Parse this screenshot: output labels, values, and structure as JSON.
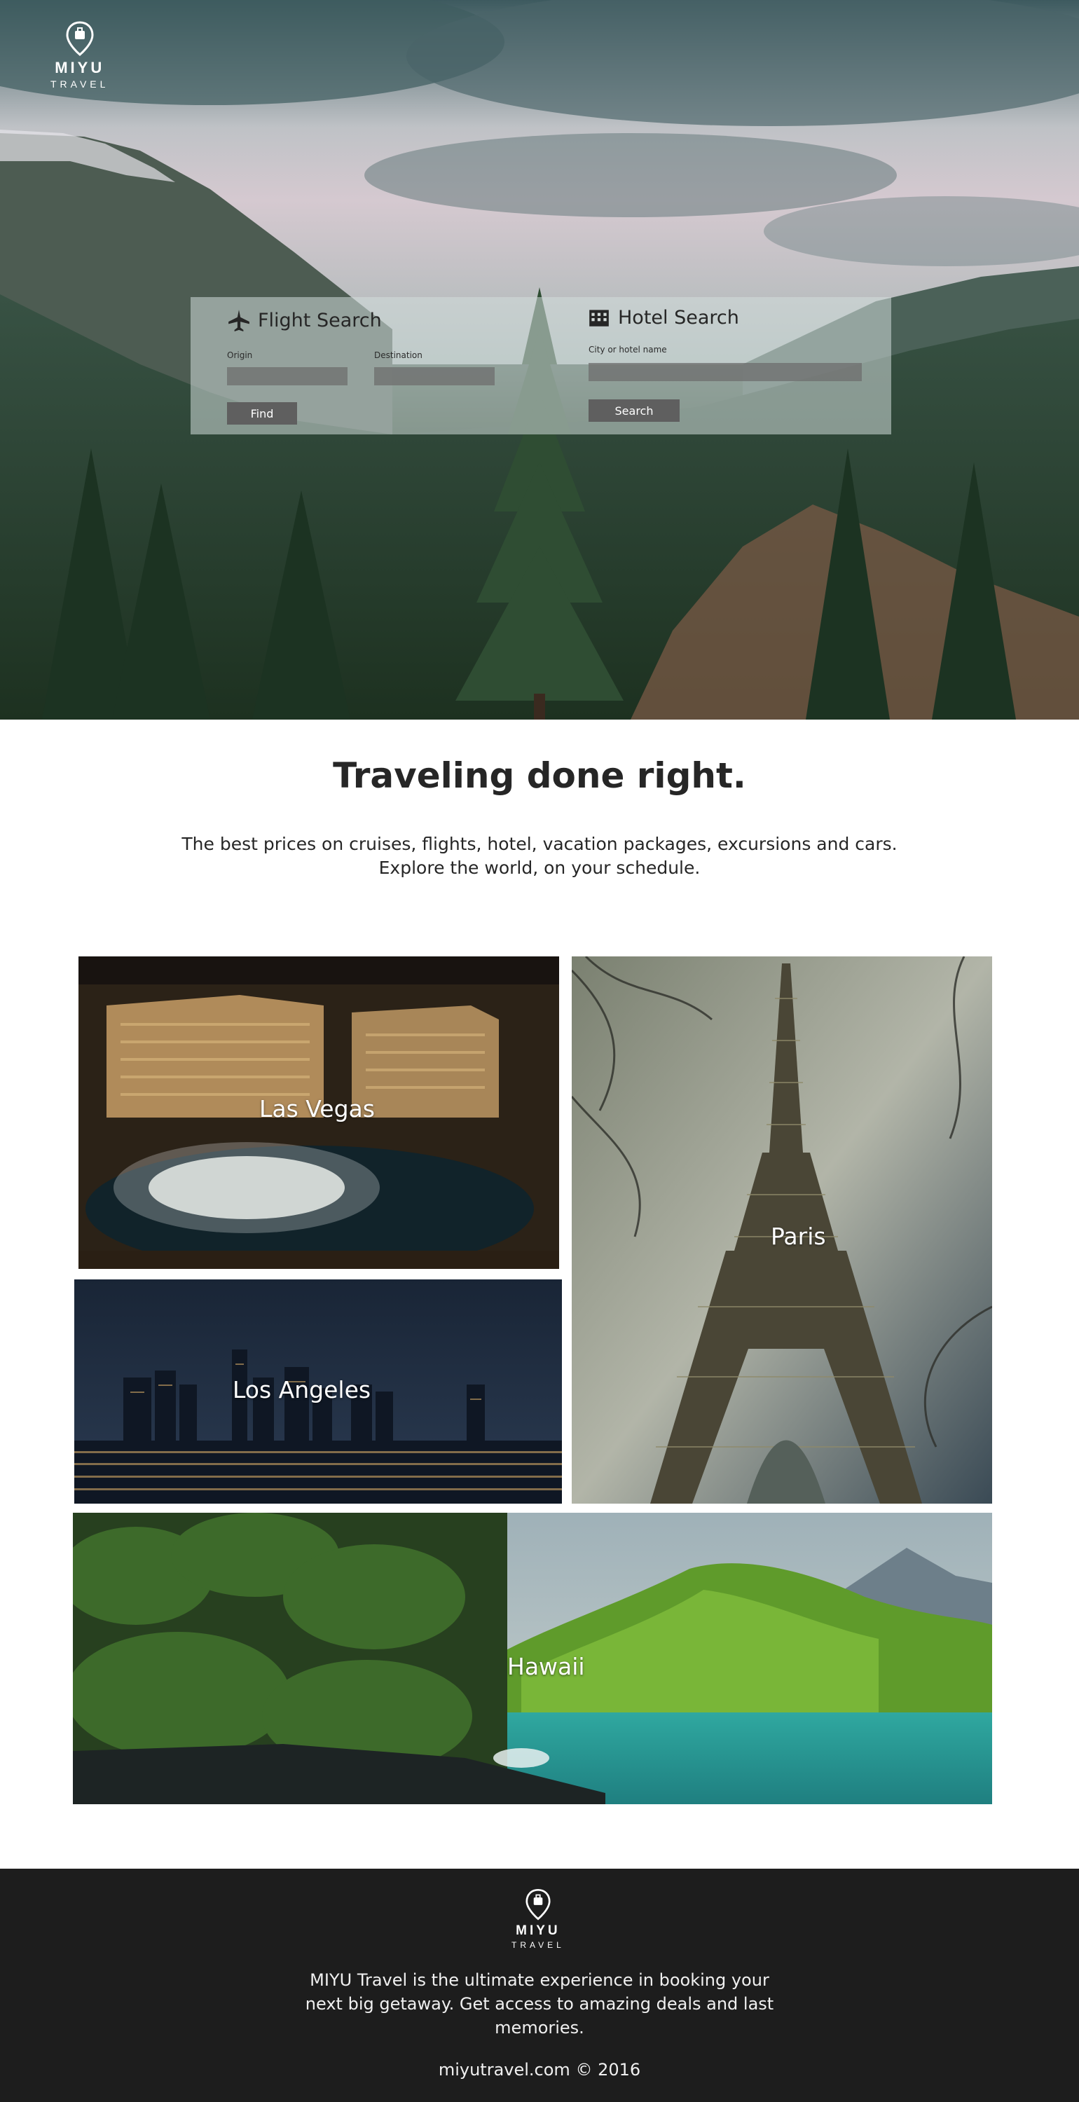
{
  "brand": {
    "name": "MIYU",
    "tagline": "TRAVEL"
  },
  "flight_search": {
    "title": "Flight Search",
    "icon": "airplane-icon",
    "origin_label": "Origin",
    "origin_value": "",
    "destination_label": "Destination",
    "destination_value": "",
    "button_label": "Find"
  },
  "hotel_search": {
    "title": "Hotel Search",
    "icon": "hotel-icon",
    "city_label": "City or hotel name",
    "city_value": "",
    "button_label": "Search"
  },
  "intro": {
    "headline": "Traveling done right.",
    "line1": "The best prices on cruises, flights, hotel, vacation packages, excursions and cars.",
    "line2": "Explore the world, on your schedule."
  },
  "destinations": [
    {
      "name": "Las Vegas"
    },
    {
      "name": "Paris"
    },
    {
      "name": "Los Angeles"
    },
    {
      "name": "Hawaii"
    }
  ],
  "footer": {
    "description": "MIYU Travel is the ultimate experience in booking your next big getaway. Get access to amazing deals and last memories.",
    "copyright": "miyutravel.com © 2016"
  },
  "colors": {
    "footer_bg": "#1d1d1d",
    "button_bg": "#5f5f5f",
    "text": "#262626"
  }
}
